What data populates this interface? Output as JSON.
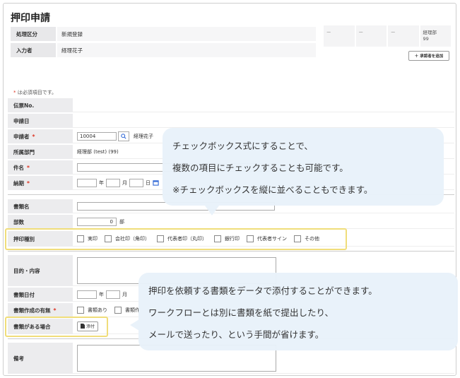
{
  "page": {
    "title": "押印申請"
  },
  "header": {
    "processing_label": "処理区分",
    "processing_value": "新規登録",
    "inputter_label": "入力者",
    "inputter_value": "経理花子"
  },
  "approvers": {
    "slots": [
      "ー",
      "ー",
      "ー",
      "経理部\n99"
    ],
    "add_button": "＋ 承認者を追加"
  },
  "required_note": {
    "star": "*",
    "text": " は必須項目です。"
  },
  "form": {
    "voucher_no": {
      "label": "伝票No."
    },
    "apply_date": {
      "label": "申請日"
    },
    "applicant": {
      "label": "申請者",
      "code": "10004",
      "name": "経理花子"
    },
    "department": {
      "label": "所属部門",
      "value": "経理部 (test) (99)"
    },
    "subject": {
      "label": "件名"
    },
    "deadline": {
      "label": "納期",
      "year": "年",
      "month": "月",
      "day": "日"
    },
    "document_name": {
      "label": "書類名"
    },
    "copies": {
      "label": "部数",
      "value": "0",
      "unit": "部"
    },
    "seal_type": {
      "label": "押印種別",
      "options": [
        "実印",
        "会社印（角印）",
        "代表者印（丸印）",
        "銀行印",
        "代表者サイン",
        "その他"
      ]
    },
    "purpose": {
      "label": "目的・内容"
    },
    "doc_date": {
      "label": "書類日付",
      "year": "年",
      "month": "月"
    },
    "doc_created": {
      "label": "書類作成の有無",
      "options": [
        "書類あり",
        "書類作"
      ]
    },
    "doc_attach": {
      "label": "書類がある場合",
      "button": "添付"
    },
    "remarks": {
      "label": "備考"
    }
  },
  "callouts": {
    "top": {
      "line1": "チェックボックス式にすることで、",
      "line2": "複数の項目にチェックすることも可能です。",
      "line3": "※チェックボックスを縦に並べることもできます。"
    },
    "bottom": {
      "line1": "押印を依頼する書類をデータで添付することができます。",
      "line2": "ワークフローとは別に書類を紙で提出したり、",
      "line3": "メールで送ったり、という手間が省けます。"
    }
  },
  "icons": {
    "search": "search-icon",
    "calendar": "calendar-icon",
    "attach": "attach-icon",
    "plus": "plus-icon"
  },
  "colors": {
    "highlight": "#f0dd7a",
    "bubble": "#e8f2fa",
    "required": "#dd3322",
    "calendar": "#3a6fd8"
  }
}
